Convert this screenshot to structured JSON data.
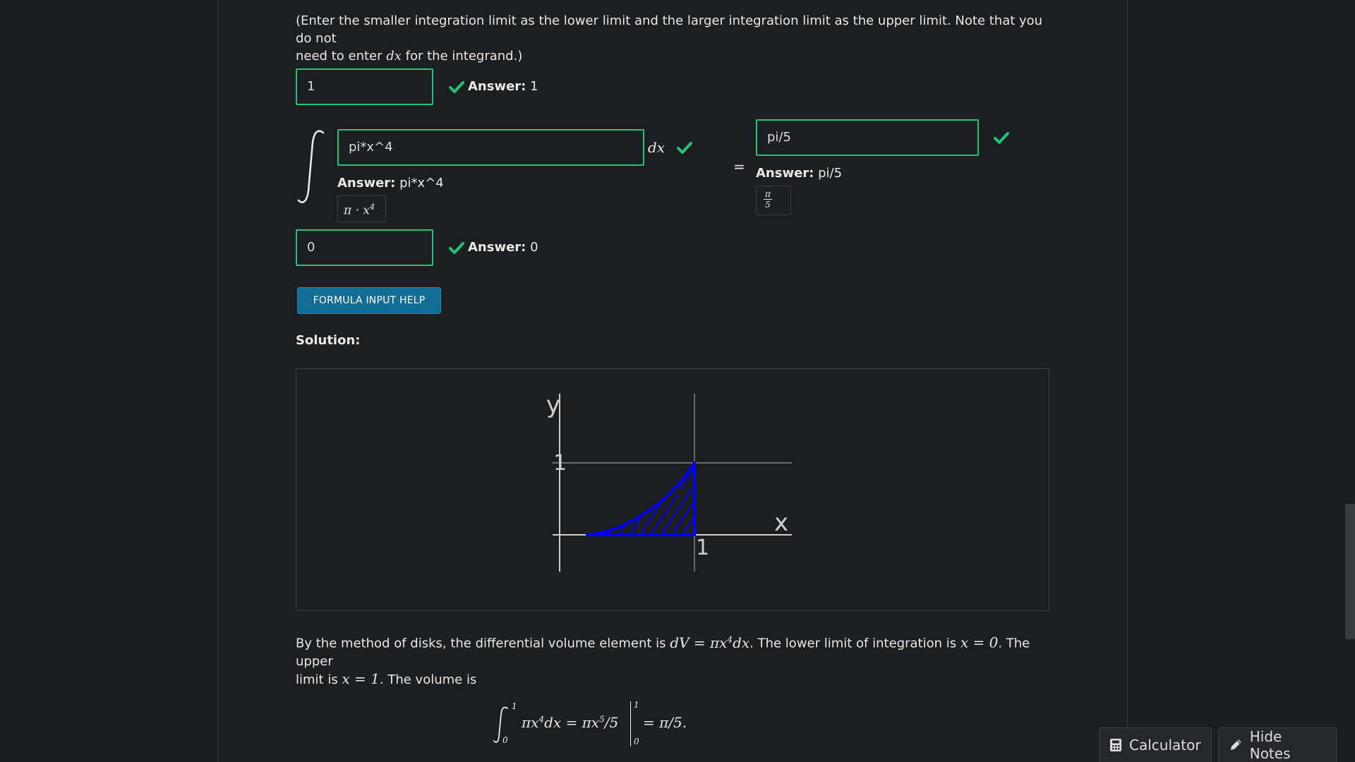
{
  "instruction": {
    "part1": "(Enter the smaller integration limit as the lower limit and the larger integration limit as the upper limit. Note that you do not",
    "part2_pre": "need to enter ",
    "part2_math": "dx",
    "part2_post": " for the integrand.)"
  },
  "upper_limit": {
    "value": "1",
    "answer_label": "Answer:",
    "answer_value": "1"
  },
  "integrand": {
    "value": "pi*x^4",
    "dx": "dx",
    "answer_label": "Answer:",
    "answer_value": "pi*x^4",
    "preview_base": "π · x",
    "preview_exp": "4"
  },
  "equals": "=",
  "result": {
    "value": "pi/5",
    "answer_label": "Answer:",
    "answer_value": "pi/5",
    "preview_num": "π",
    "preview_den": "5"
  },
  "lower_limit": {
    "value": "0",
    "answer_label": "Answer:",
    "answer_value": "0"
  },
  "help_button": "FORMULA INPUT HELP",
  "solution_label": "Solution:",
  "graph": {
    "y_label": "y",
    "x_label": "x",
    "y_tick": "1",
    "x_tick": "1"
  },
  "explanation": {
    "t1": "By the method of disks, the differential volume element is ",
    "m1": "dV = πx",
    "m1_exp": "4",
    "m1_end": "dx",
    "t2": ". The lower limit of integration is ",
    "m2": "x = 0",
    "t3": ". The upper",
    "t4": "limit is ",
    "m3": "x = 1",
    "t5": ". The volume is"
  },
  "formula": {
    "upper": "1",
    "lower": "0",
    "body": "πx",
    "exp1": "4",
    "dx": "dx = πx",
    "exp2": "5",
    "div": "/5",
    "eval_upper": "1",
    "eval_lower": "0",
    "result": "= π/5."
  },
  "footer": {
    "calculator": "Calculator",
    "hide_notes": "Hide Notes"
  },
  "colors": {
    "accent_green": "#1fc47a",
    "button_blue": "#136c94",
    "curve_blue": "#0000ff"
  }
}
